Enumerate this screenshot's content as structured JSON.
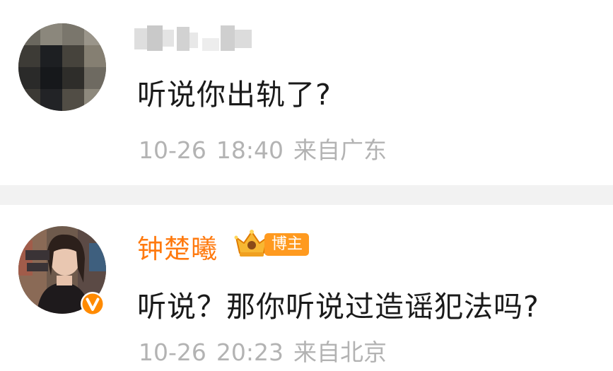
{
  "comments": [
    {
      "username_blurred": true,
      "text": "听说你出轨了?",
      "date": "10-26",
      "time": "18:40",
      "location": "来自广东"
    },
    {
      "username": "钟楚曦",
      "badge": "博主",
      "text": "听说？那你听说过造谣犯法吗?",
      "date": "10-26",
      "time": "20:23",
      "location": "来自北京"
    }
  ],
  "colors": {
    "username_orange": "#ff7a0f",
    "badge_orange": "#ff9a1f",
    "meta_gray": "#b3b3b3",
    "text": "#1a1a1a",
    "divider": "#f2f2f2"
  },
  "icons": [
    "crown-icon",
    "verified-icon"
  ]
}
